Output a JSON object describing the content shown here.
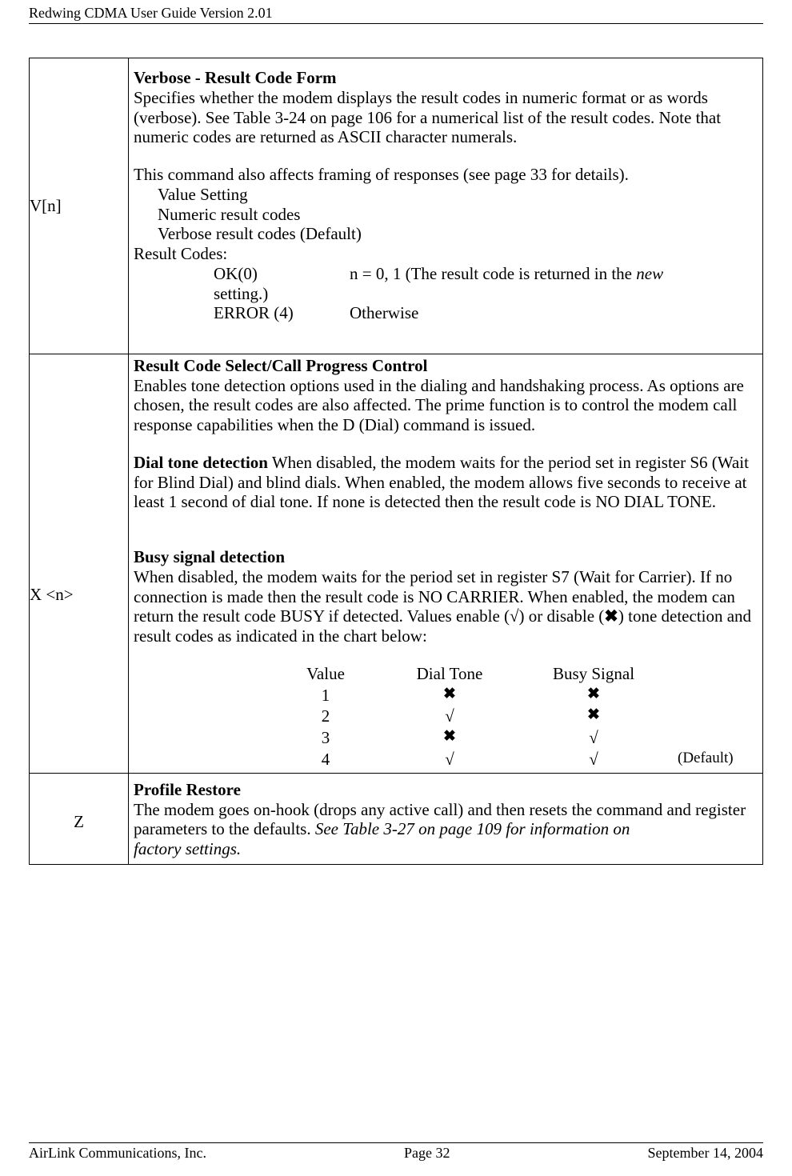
{
  "header": "Redwing CDMA User Guide Version 2.01",
  "rows": [
    {
      "cmd": "V[n]",
      "title": "Verbose - Result Code Form",
      "p1": "Specifies whether the modem displays the result codes in numeric format or as words (verbose). See Table 3-24 on page 106 for a numerical list of the result codes. Note that numeric codes are returned as ASCII character numerals.",
      "p2": "This command also affects framing of responses (see page 33 for details).",
      "list": [
        "Value Setting",
        "Numeric result codes",
        "Verbose result codes (Default)"
      ],
      "rc_label": "Result Codes:",
      "rc": {
        "ok": "OK(0)",
        "ok_txt_a": "n = 0, 1 (The result code is returned in the ",
        "ok_txt_new": "new",
        "setting": "setting.)",
        "err": "ERROR (4)",
        "err_txt": "Otherwise"
      }
    },
    {
      "cmd": "X <n>",
      "title": "Result Code Select/Call Progress Control",
      "p1": "Enables tone detection options used in the dialing and handshaking process. As options are chosen, the result codes are also affected. The prime function is to control the modem call response capabilities when the D (Dial) command is issued.",
      "h2": "Dial tone detection",
      "p2": " When disabled, the modem waits for the period set in register S6 (Wait for Blind Dial) and blind dials. When enabled, the modem allows five seconds to receive at least 1 second of dial tone. If none is detected then the result code is NO DIAL TONE.",
      "h3": "Busy signal detection",
      "p3a": "When disabled, the modem waits for the period set in register S7 (Wait for Carrier). If no connection is made then the result code is NO CARRIER. When enabled, the modem can return the result code BUSY if detected. Values enable (",
      "p3b": "√",
      "p3c": ") or disable (",
      "p3d": "✖",
      "p3e": ") tone detection and result codes as indicated in the chart below:",
      "chart": {
        "h1": "Value",
        "h2": "Dial Tone",
        "h3": "Busy Signal",
        "v1": "1",
        "d1": "✖",
        "b1": "✖",
        "v2": "2",
        "d2": "√",
        "b2": "✖",
        "v3": "3",
        "d3": "✖",
        "b3": "√",
        "v4": "4",
        "d4": "√",
        "b4": "√",
        "def": "(Default)"
      }
    },
    {
      "cmd": "Z",
      "title": "Profile Restore",
      "p1": "The modem goes on-hook (drops any active call) and then resets the command and register parameters to the defaults. ",
      "p1i": "See Table 3-27 on page 109 for information on",
      "p2i": "factory settings."
    }
  ],
  "footer": {
    "left": "AirLink Communications, Inc.",
    "center": "Page 32",
    "right": "September 14, 2004"
  }
}
